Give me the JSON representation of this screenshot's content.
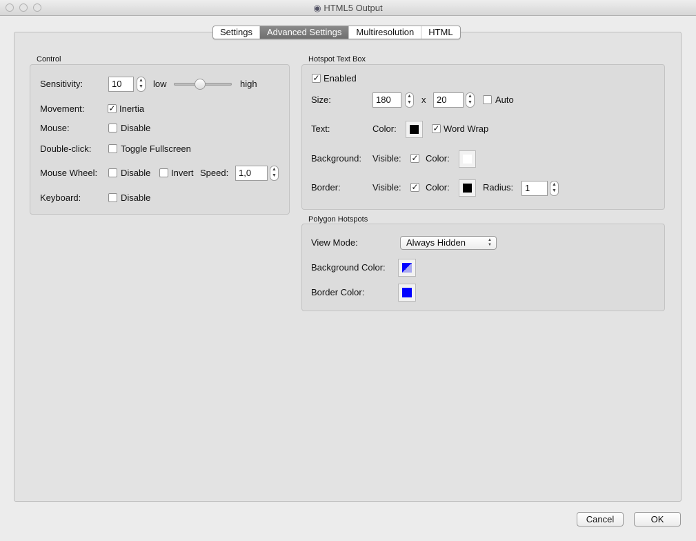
{
  "window": {
    "title": "HTML5 Output"
  },
  "tabs": [
    {
      "label": "Settings"
    },
    {
      "label": "Advanced Settings",
      "selected": true
    },
    {
      "label": "Multiresolution"
    },
    {
      "label": "HTML"
    }
  ],
  "control": {
    "title": "Control",
    "sensitivity": {
      "label": "Sensitivity:",
      "value": "10",
      "low": "low",
      "high": "high",
      "slider_fraction": 0.45
    },
    "movement": {
      "label": "Movement:",
      "inertia_label": "Inertia",
      "inertia_checked": true
    },
    "mouse": {
      "label": "Mouse:",
      "disable_label": "Disable",
      "checked": false
    },
    "double_click": {
      "label": "Double-click:",
      "toggle_label": "Toggle Fullscreen",
      "checked": false
    },
    "mouse_wheel": {
      "label": "Mouse Wheel:",
      "disable_label": "Disable",
      "invert_label": "Invert",
      "speed_label": "Speed:",
      "speed_value": "1,0"
    },
    "keyboard": {
      "label": "Keyboard:",
      "disable_label": "Disable",
      "checked": false
    }
  },
  "hotspot_text_box": {
    "title": "Hotspot Text Box",
    "enabled_label": "Enabled",
    "enabled": true,
    "size": {
      "label": "Size:",
      "width": "180",
      "x": "x",
      "height": "20",
      "auto_label": "Auto",
      "auto": false
    },
    "text": {
      "label": "Text:",
      "color_label": "Color:",
      "color": "#000000",
      "word_wrap_label": "Word Wrap",
      "word_wrap": true
    },
    "background": {
      "label": "Background:",
      "visible_label": "Visible:",
      "visible": true,
      "color_label": "Color:",
      "color": "#ffffff"
    },
    "border": {
      "label": "Border:",
      "visible_label": "Visible:",
      "visible": true,
      "color_label": "Color:",
      "color": "#000000",
      "radius_label": "Radius:",
      "radius": "1"
    }
  },
  "polygon_hotspots": {
    "title": "Polygon Hotspots",
    "view_mode": {
      "label": "View Mode:",
      "value": "Always Hidden"
    },
    "background_color": {
      "label": "Background Color:",
      "color": "#0000ff"
    },
    "border_color": {
      "label": "Border Color:",
      "color": "#0000ff"
    }
  },
  "buttons": {
    "cancel": "Cancel",
    "ok": "OK"
  }
}
